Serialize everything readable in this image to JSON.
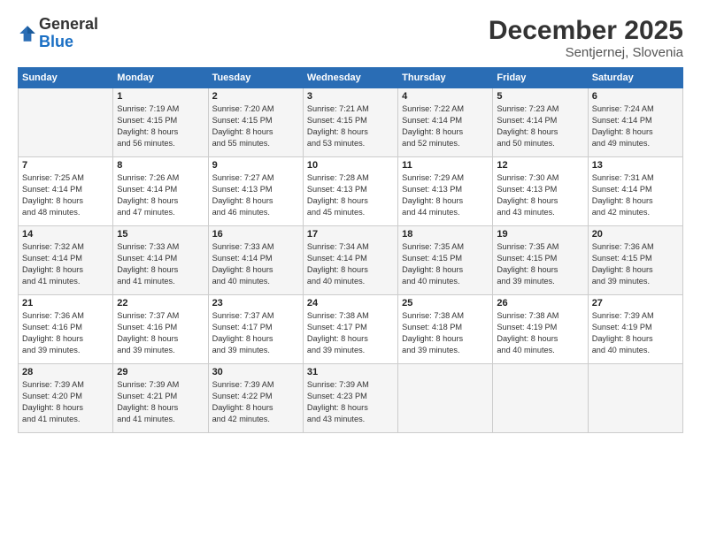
{
  "logo": {
    "general": "General",
    "blue": "Blue"
  },
  "title": "December 2025",
  "subtitle": "Sentjernej, Slovenia",
  "header_days": [
    "Sunday",
    "Monday",
    "Tuesday",
    "Wednesday",
    "Thursday",
    "Friday",
    "Saturday"
  ],
  "weeks": [
    [
      {
        "day": "",
        "sunrise": "",
        "sunset": "",
        "daylight": ""
      },
      {
        "day": "1",
        "sunrise": "Sunrise: 7:19 AM",
        "sunset": "Sunset: 4:15 PM",
        "daylight": "Daylight: 8 hours and 56 minutes."
      },
      {
        "day": "2",
        "sunrise": "Sunrise: 7:20 AM",
        "sunset": "Sunset: 4:15 PM",
        "daylight": "Daylight: 8 hours and 55 minutes."
      },
      {
        "day": "3",
        "sunrise": "Sunrise: 7:21 AM",
        "sunset": "Sunset: 4:15 PM",
        "daylight": "Daylight: 8 hours and 53 minutes."
      },
      {
        "day": "4",
        "sunrise": "Sunrise: 7:22 AM",
        "sunset": "Sunset: 4:14 PM",
        "daylight": "Daylight: 8 hours and 52 minutes."
      },
      {
        "day": "5",
        "sunrise": "Sunrise: 7:23 AM",
        "sunset": "Sunset: 4:14 PM",
        "daylight": "Daylight: 8 hours and 50 minutes."
      },
      {
        "day": "6",
        "sunrise": "Sunrise: 7:24 AM",
        "sunset": "Sunset: 4:14 PM",
        "daylight": "Daylight: 8 hours and 49 minutes."
      }
    ],
    [
      {
        "day": "7",
        "sunrise": "Sunrise: 7:25 AM",
        "sunset": "Sunset: 4:14 PM",
        "daylight": "Daylight: 8 hours and 48 minutes."
      },
      {
        "day": "8",
        "sunrise": "Sunrise: 7:26 AM",
        "sunset": "Sunset: 4:14 PM",
        "daylight": "Daylight: 8 hours and 47 minutes."
      },
      {
        "day": "9",
        "sunrise": "Sunrise: 7:27 AM",
        "sunset": "Sunset: 4:13 PM",
        "daylight": "Daylight: 8 hours and 46 minutes."
      },
      {
        "day": "10",
        "sunrise": "Sunrise: 7:28 AM",
        "sunset": "Sunset: 4:13 PM",
        "daylight": "Daylight: 8 hours and 45 minutes."
      },
      {
        "day": "11",
        "sunrise": "Sunrise: 7:29 AM",
        "sunset": "Sunset: 4:13 PM",
        "daylight": "Daylight: 8 hours and 44 minutes."
      },
      {
        "day": "12",
        "sunrise": "Sunrise: 7:30 AM",
        "sunset": "Sunset: 4:13 PM",
        "daylight": "Daylight: 8 hours and 43 minutes."
      },
      {
        "day": "13",
        "sunrise": "Sunrise: 7:31 AM",
        "sunset": "Sunset: 4:14 PM",
        "daylight": "Daylight: 8 hours and 42 minutes."
      }
    ],
    [
      {
        "day": "14",
        "sunrise": "Sunrise: 7:32 AM",
        "sunset": "Sunset: 4:14 PM",
        "daylight": "Daylight: 8 hours and 41 minutes."
      },
      {
        "day": "15",
        "sunrise": "Sunrise: 7:33 AM",
        "sunset": "Sunset: 4:14 PM",
        "daylight": "Daylight: 8 hours and 41 minutes."
      },
      {
        "day": "16",
        "sunrise": "Sunrise: 7:33 AM",
        "sunset": "Sunset: 4:14 PM",
        "daylight": "Daylight: 8 hours and 40 minutes."
      },
      {
        "day": "17",
        "sunrise": "Sunrise: 7:34 AM",
        "sunset": "Sunset: 4:14 PM",
        "daylight": "Daylight: 8 hours and 40 minutes."
      },
      {
        "day": "18",
        "sunrise": "Sunrise: 7:35 AM",
        "sunset": "Sunset: 4:15 PM",
        "daylight": "Daylight: 8 hours and 40 minutes."
      },
      {
        "day": "19",
        "sunrise": "Sunrise: 7:35 AM",
        "sunset": "Sunset: 4:15 PM",
        "daylight": "Daylight: 8 hours and 39 minutes."
      },
      {
        "day": "20",
        "sunrise": "Sunrise: 7:36 AM",
        "sunset": "Sunset: 4:15 PM",
        "daylight": "Daylight: 8 hours and 39 minutes."
      }
    ],
    [
      {
        "day": "21",
        "sunrise": "Sunrise: 7:36 AM",
        "sunset": "Sunset: 4:16 PM",
        "daylight": "Daylight: 8 hours and 39 minutes."
      },
      {
        "day": "22",
        "sunrise": "Sunrise: 7:37 AM",
        "sunset": "Sunset: 4:16 PM",
        "daylight": "Daylight: 8 hours and 39 minutes."
      },
      {
        "day": "23",
        "sunrise": "Sunrise: 7:37 AM",
        "sunset": "Sunset: 4:17 PM",
        "daylight": "Daylight: 8 hours and 39 minutes."
      },
      {
        "day": "24",
        "sunrise": "Sunrise: 7:38 AM",
        "sunset": "Sunset: 4:17 PM",
        "daylight": "Daylight: 8 hours and 39 minutes."
      },
      {
        "day": "25",
        "sunrise": "Sunrise: 7:38 AM",
        "sunset": "Sunset: 4:18 PM",
        "daylight": "Daylight: 8 hours and 39 minutes."
      },
      {
        "day": "26",
        "sunrise": "Sunrise: 7:38 AM",
        "sunset": "Sunset: 4:19 PM",
        "daylight": "Daylight: 8 hours and 40 minutes."
      },
      {
        "day": "27",
        "sunrise": "Sunrise: 7:39 AM",
        "sunset": "Sunset: 4:19 PM",
        "daylight": "Daylight: 8 hours and 40 minutes."
      }
    ],
    [
      {
        "day": "28",
        "sunrise": "Sunrise: 7:39 AM",
        "sunset": "Sunset: 4:20 PM",
        "daylight": "Daylight: 8 hours and 41 minutes."
      },
      {
        "day": "29",
        "sunrise": "Sunrise: 7:39 AM",
        "sunset": "Sunset: 4:21 PM",
        "daylight": "Daylight: 8 hours and 41 minutes."
      },
      {
        "day": "30",
        "sunrise": "Sunrise: 7:39 AM",
        "sunset": "Sunset: 4:22 PM",
        "daylight": "Daylight: 8 hours and 42 minutes."
      },
      {
        "day": "31",
        "sunrise": "Sunrise: 7:39 AM",
        "sunset": "Sunset: 4:23 PM",
        "daylight": "Daylight: 8 hours and 43 minutes."
      },
      {
        "day": "",
        "sunrise": "",
        "sunset": "",
        "daylight": ""
      },
      {
        "day": "",
        "sunrise": "",
        "sunset": "",
        "daylight": ""
      },
      {
        "day": "",
        "sunrise": "",
        "sunset": "",
        "daylight": ""
      }
    ]
  ]
}
